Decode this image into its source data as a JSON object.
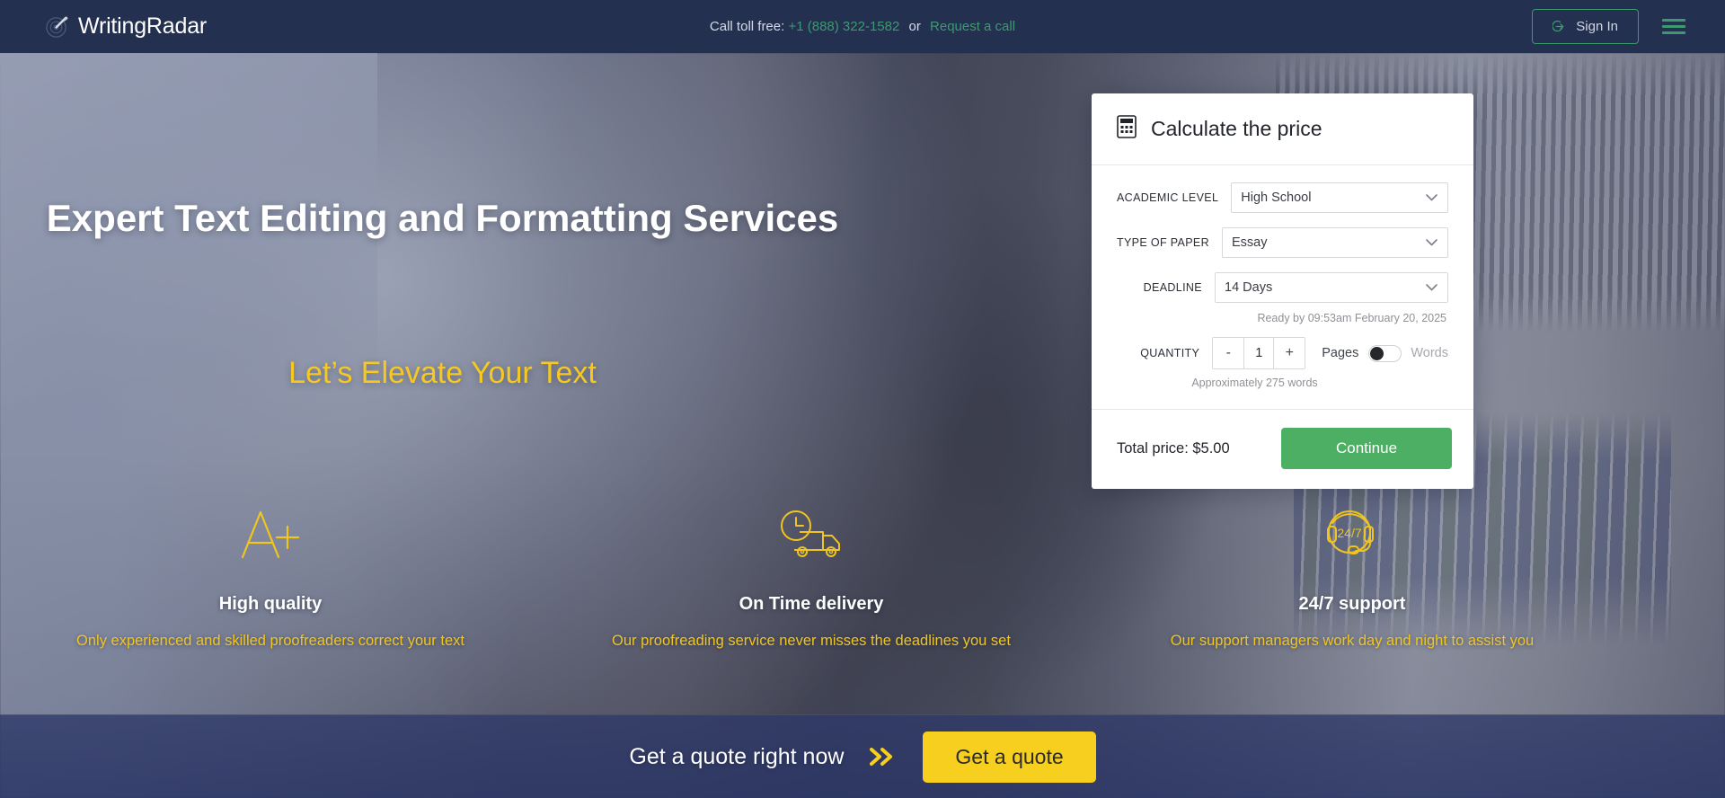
{
  "header": {
    "brand_name": "WritingRadar",
    "brand_icon": "radar-pen-icon",
    "call_label": "Call toll free:",
    "phone": "+1 (888) 322-1582",
    "or_label": "or",
    "request_call": "Request a call",
    "sign_in": "Sign In",
    "sign_in_icon": "sign-in-arrow-icon",
    "menu_icon": "hamburger-menu-icon"
  },
  "hero": {
    "heading": "Expert Text Editing and Formatting Services",
    "subheading": "Let’s Elevate Your Text"
  },
  "features": [
    {
      "icon": "a-plus-grade-icon",
      "title": "High quality",
      "description": "Only experienced and skilled proofreaders correct your text"
    },
    {
      "icon": "delivery-truck-clock-icon",
      "title": "On Time delivery",
      "description": "Our proofreading service never misses the deadlines you set"
    },
    {
      "icon": "headset-24-7-icon",
      "title": "24/7 support",
      "description": "Our support managers work day and night to assist you"
    }
  ],
  "calculator": {
    "title": "Calculate the price",
    "title_icon": "calculator-icon",
    "fields": [
      {
        "label": "ACADEMIC LEVEL",
        "value": "High School"
      },
      {
        "label": "TYPE OF PAPER",
        "value": "Essay"
      },
      {
        "label": "DEADLINE",
        "value": "14 Days"
      }
    ],
    "ready_by": "Ready by 09:53am February 20, 2025",
    "quantity_label": "QUANTITY",
    "decrement": "-",
    "quantity_value": "1",
    "increment": "+",
    "unit_pages": "Pages",
    "unit_words": "Words",
    "words_note": "Approximately 275 words",
    "total_price": "Total price: $5.00",
    "continue_label": "Continue"
  },
  "cta": {
    "text": "Get a quote right now",
    "chevron_icon": "double-chevron-right-icon",
    "button_label": "Get a quote"
  },
  "colors": {
    "header_bg": "#24304f",
    "accent_green": "#3d9970",
    "continue_green": "#4caf63",
    "accent_yellow": "#f5c823",
    "cta_yellow": "#f7cf1e"
  }
}
